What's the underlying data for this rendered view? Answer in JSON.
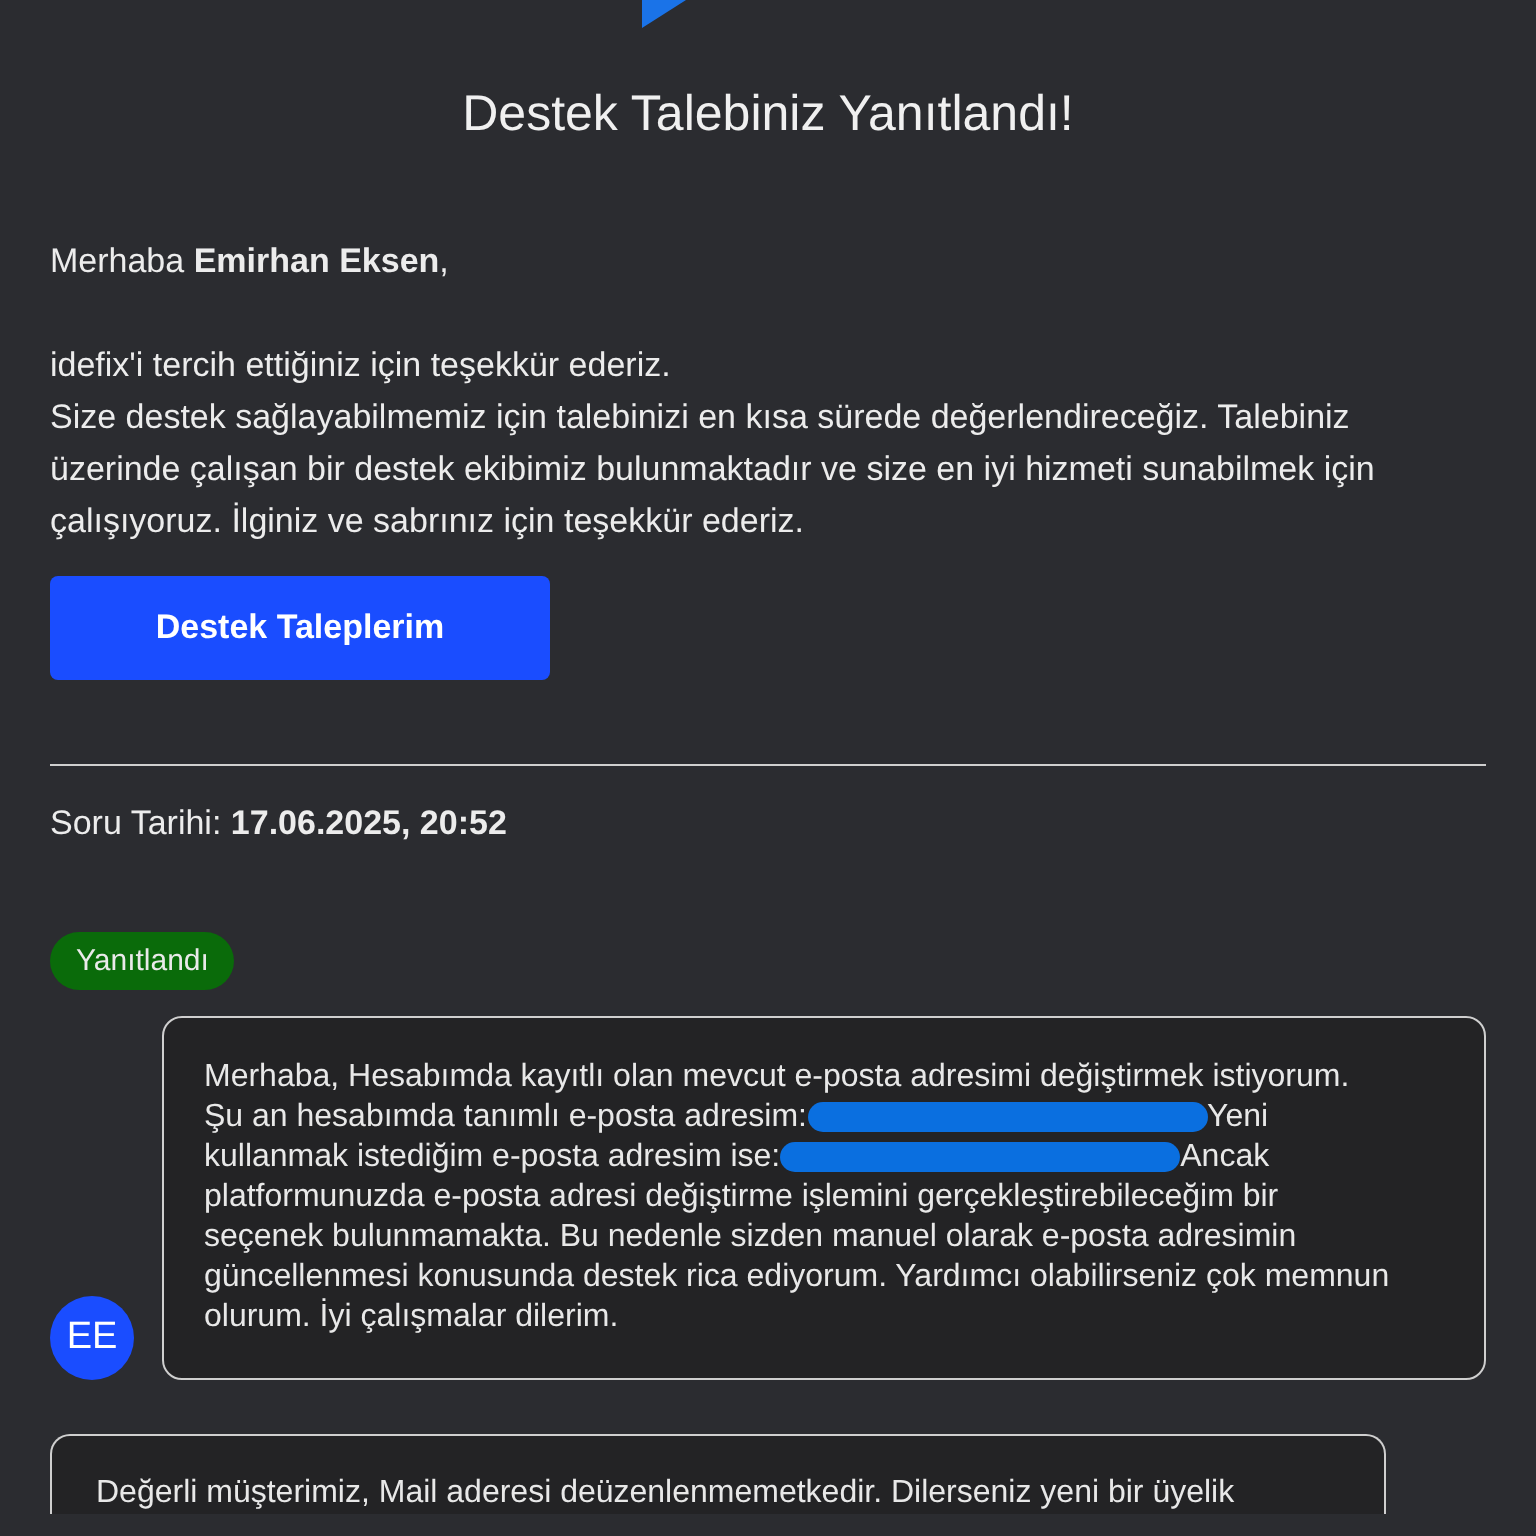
{
  "title": "Destek Talebiniz Yanıtlandı!",
  "greeting": {
    "prefix": "Merhaba ",
    "name": "Emirhan Eksen",
    "suffix": ","
  },
  "intro": [
    "idefix'i tercih ettiğiniz için teşekkür ederiz.",
    "Size destek sağlayabilmemiz için talebinizi en kısa sürede değerlendireceğiz. Talebiniz üzerinde çalışan bir destek ekibimiz bulunmaktadır ve size en iyi hizmeti sunabilmek için çalışıyoruz. İlginiz ve sabrınız için teşekkür ederiz."
  ],
  "button": "Destek Taleplerim",
  "question_date": {
    "label": "Soru Tarihi: ",
    "value": "17.06.2025, 20:52"
  },
  "status_badge": "Yanıtlandı",
  "messages": [
    {
      "avatar": "EE",
      "segments": [
        {
          "kind": "text",
          "text": "Merhaba, Hesabımda kayıtlı olan mevcut e-posta adresimi değiştirmek istiyorum. Şu an hesabımda tanımlı e-posta adresim:"
        },
        {
          "kind": "redacted"
        },
        {
          "kind": "text",
          "text": "Yeni kullanmak istediğim e-posta adresim ise:"
        },
        {
          "kind": "redacted"
        },
        {
          "kind": "text",
          "text": "Ancak platformunuzda e-posta adresi değiştirme işlemini gerçekleştirebileceğim bir seçenek bulunmamakta. Bu nedenle sizden manuel olarak e-posta adresimin güncellenmesi konusunda destek rica ediyorum. Yardımcı olabilirseniz çok memnun olurum. İyi çalışmalar dilerim."
        }
      ]
    },
    {
      "segments": [
        {
          "kind": "text",
          "text": "Değerli müşterimiz, Mail aderesi deüzenlenmemetkedir. Dilerseniz yeni bir üyelik"
        }
      ]
    }
  ]
}
